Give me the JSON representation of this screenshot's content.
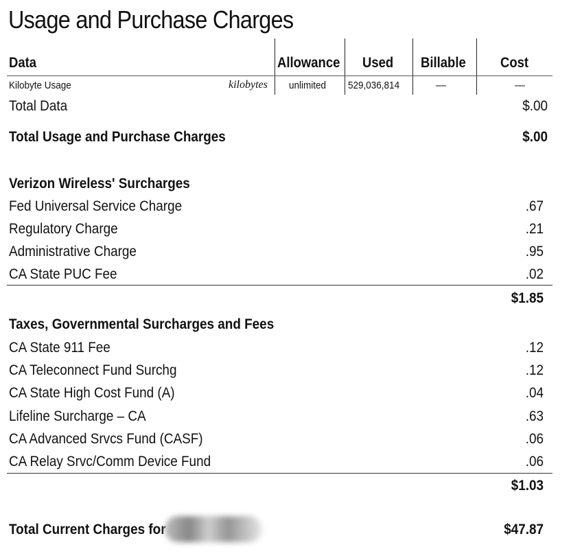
{
  "title": "Usage and Purchase Charges",
  "data_table": {
    "headers": {
      "section": "Data",
      "allowance": "Allowance",
      "used": "Used",
      "billable": "Billable",
      "cost": "Cost"
    },
    "row": {
      "label": "Kilobyte Usage",
      "unit": "kilobytes",
      "allowance": "unlimited",
      "used": "529,036,814",
      "billable": "––",
      "cost": "––"
    }
  },
  "total_data": {
    "label": "Total Data",
    "amount": "$.00"
  },
  "total_usage": {
    "label": "Total Usage and Purchase Charges",
    "amount": "$.00"
  },
  "surcharges": {
    "heading": "Verizon Wireless' Surcharges",
    "items": [
      {
        "label": "Fed Universal Service Charge",
        "amount": ".67"
      },
      {
        "label": "Regulatory Charge",
        "amount": ".21"
      },
      {
        "label": "Administrative Charge",
        "amount": ".95"
      },
      {
        "label": "CA State PUC Fee",
        "amount": ".02"
      }
    ],
    "total": "$1.85"
  },
  "taxes": {
    "heading": "Taxes, Governmental Surcharges and Fees",
    "items": [
      {
        "label": "CA State 911 Fee",
        "amount": ".12"
      },
      {
        "label": "CA Teleconnect Fund Surchg",
        "amount": ".12"
      },
      {
        "label": "CA State High Cost Fund (A)",
        "amount": ".04"
      },
      {
        "label": "Lifeline Surcharge – CA",
        "amount": ".63"
      },
      {
        "label": "CA Advanced Srvcs Fund (CASF)",
        "amount": ".06"
      },
      {
        "label": "CA Relay Srvc/Comm Device Fund",
        "amount": ".06"
      }
    ],
    "total": "$1.03"
  },
  "grand_total": {
    "label": "Total Current Charges for",
    "amount": "$47.87"
  }
}
